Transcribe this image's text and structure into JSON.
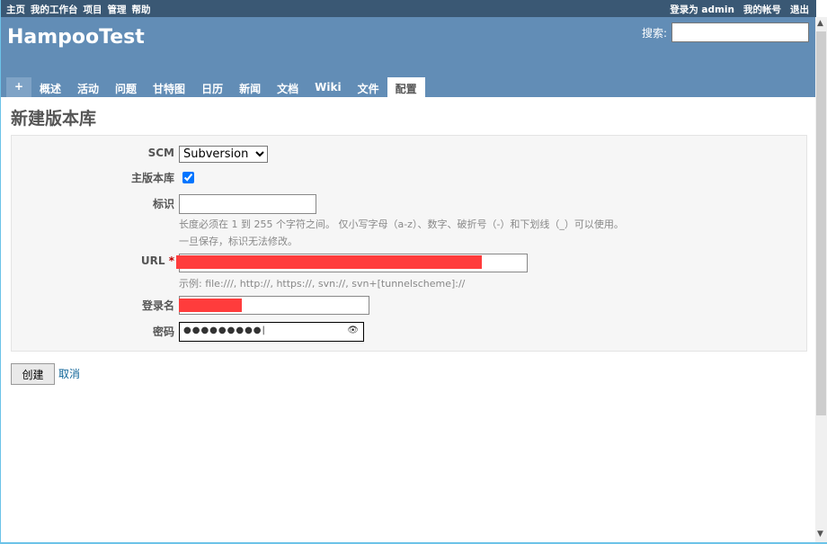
{
  "top_menu": {
    "left": [
      "主页",
      "我的工作台",
      "项目",
      "管理",
      "帮助"
    ],
    "logged_in": "登录为 admin",
    "my_account": "我的帐号",
    "logout": "退出"
  },
  "header": {
    "title": "HampooTest",
    "search_label": "搜索:",
    "search_value": ""
  },
  "tabs": [
    "+",
    "概述",
    "活动",
    "问题",
    "甘特图",
    "日历",
    "新闻",
    "文档",
    "Wiki",
    "文件",
    "配置"
  ],
  "page": {
    "title": "新建版本库"
  },
  "form": {
    "scm_label": "SCM",
    "scm_value": "Subversion",
    "main_label": "主版本库",
    "main_checked": true,
    "ident_label": "标识",
    "ident_value": "",
    "ident_hint1": "长度必须在 1 到 255 个字符之间。 仅小写字母（a-z）、数字、破折号（-）和下划线（_）可以使用。",
    "ident_hint2": "一旦保存，标识无法修改。",
    "url_label": "URL",
    "required_mark": "*",
    "url_hint": "示例: file:///, http://, https://, svn://, svn+[tunnelscheme]://",
    "login_label": "登录名",
    "password_label": "密码",
    "password_value": "●●●●●●●●●"
  },
  "actions": {
    "create": "创建",
    "cancel": "取消"
  }
}
